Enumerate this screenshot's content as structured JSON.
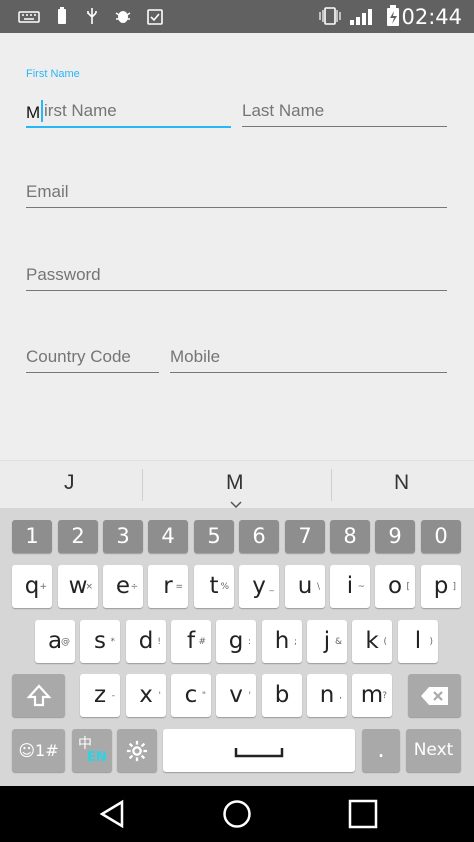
{
  "status_bar": {
    "time": "02:44",
    "icons": [
      "keyboard-icon",
      "battery-saver-icon",
      "usb-icon",
      "bug-icon",
      "clipboard-check-icon",
      "vibrate-icon",
      "signal-icon",
      "battery-charging-icon"
    ]
  },
  "form": {
    "first_name_label": "First Name",
    "first_name_value": "M",
    "first_name_placeholder": "irst Name",
    "last_name_placeholder": "Last Name",
    "email_placeholder": "Email",
    "password_placeholder": "Password",
    "country_code_placeholder": "Country Code",
    "mobile_placeholder": "Mobile"
  },
  "suggestions": [
    "J",
    "M",
    "N"
  ],
  "keyboard": {
    "numbers": [
      "1",
      "2",
      "3",
      "4",
      "5",
      "6",
      "7",
      "8",
      "9",
      "0"
    ],
    "row1": [
      "q",
      "w",
      "e",
      "r",
      "t",
      "y",
      "u",
      "i",
      "o",
      "p"
    ],
    "row1_sec": [
      "+",
      "×",
      "÷",
      "=",
      "%",
      "_",
      "\\",
      "~",
      "[",
      "]"
    ],
    "row2": [
      "a",
      "s",
      "d",
      "f",
      "g",
      "h",
      "j",
      "k",
      "l"
    ],
    "row2_sec": [
      "@",
      "*",
      "!",
      "#",
      ":",
      ";",
      "&",
      "(",
      ")"
    ],
    "row3": [
      "z",
      "x",
      "c",
      "v",
      "b",
      "n",
      "m"
    ],
    "row3_sec": [
      "-",
      "'",
      "\"",
      "'",
      "",
      ",",
      "?"
    ],
    "emoji_label": "☺1#",
    "lang_label": "EN",
    "lang_han": "中",
    "period": ".",
    "next": "Next"
  },
  "colors": {
    "accent": "#29b6f6",
    "statusbar": "#616161",
    "keyboard_bg": "#d6d6d6",
    "num_key": "#8e8e8e"
  }
}
